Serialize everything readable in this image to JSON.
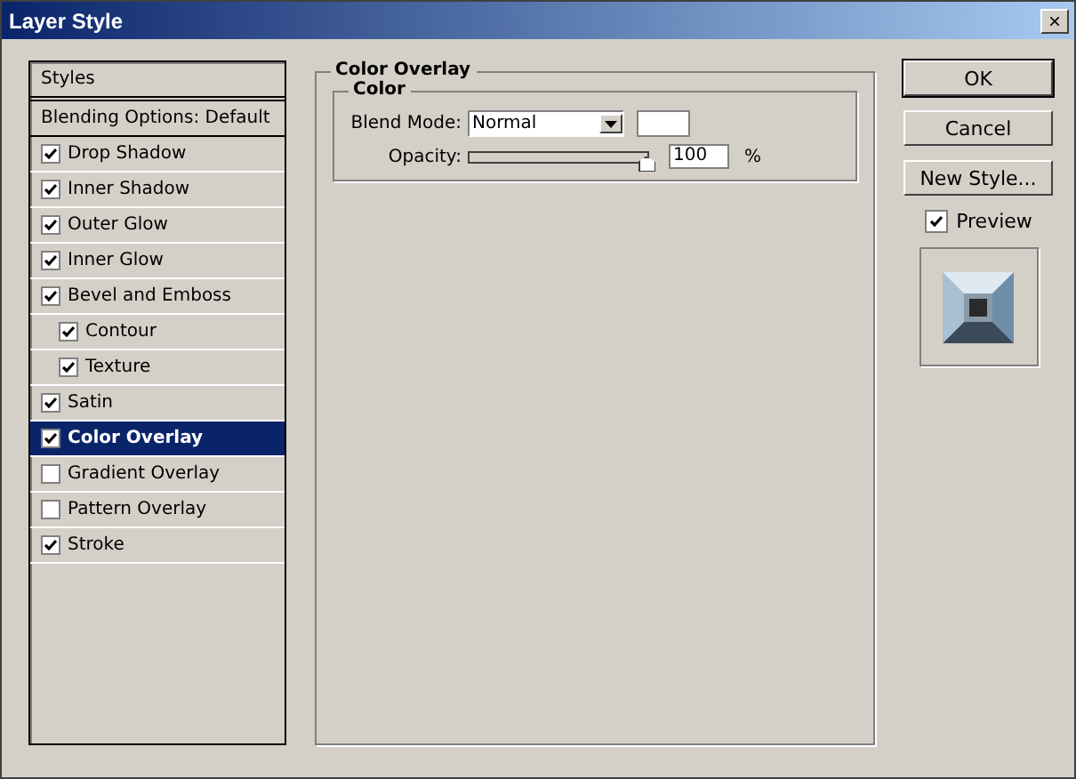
{
  "window": {
    "title": "Layer Style",
    "close": "×"
  },
  "styles_panel": {
    "header": "Styles",
    "blending_options": "Blending Options: Default",
    "items": [
      {
        "label": "Drop Shadow",
        "checked": true,
        "selected": false
      },
      {
        "label": "Inner Shadow",
        "checked": true,
        "selected": false
      },
      {
        "label": "Outer Glow",
        "checked": true,
        "selected": false
      },
      {
        "label": "Inner Glow",
        "checked": true,
        "selected": false
      },
      {
        "label": "Bevel and Emboss",
        "checked": true,
        "selected": false,
        "children": [
          {
            "label": "Contour",
            "checked": true,
            "selected": false
          },
          {
            "label": "Texture",
            "checked": true,
            "selected": false
          }
        ]
      },
      {
        "label": "Satin",
        "checked": true,
        "selected": false
      },
      {
        "label": "Color Overlay",
        "checked": true,
        "selected": true
      },
      {
        "label": "Gradient Overlay",
        "checked": false,
        "selected": false
      },
      {
        "label": "Pattern Overlay",
        "checked": false,
        "selected": false
      },
      {
        "label": "Stroke",
        "checked": true,
        "selected": false
      }
    ]
  },
  "settings": {
    "title": "Color Overlay",
    "group": "Color",
    "blend_mode": {
      "label": "Blend Mode:",
      "value": "Normal",
      "color": "#ffffff"
    },
    "opacity": {
      "label": "Opacity:",
      "level": 1,
      "value": "100",
      "unit": "%"
    }
  },
  "buttons": [
    {
      "label": "OK",
      "default": true
    },
    {
      "label": "Cancel",
      "default": false
    },
    {
      "label": "New Style...",
      "default": false
    }
  ],
  "preview": {
    "label": "Preview",
    "checked": true
  }
}
